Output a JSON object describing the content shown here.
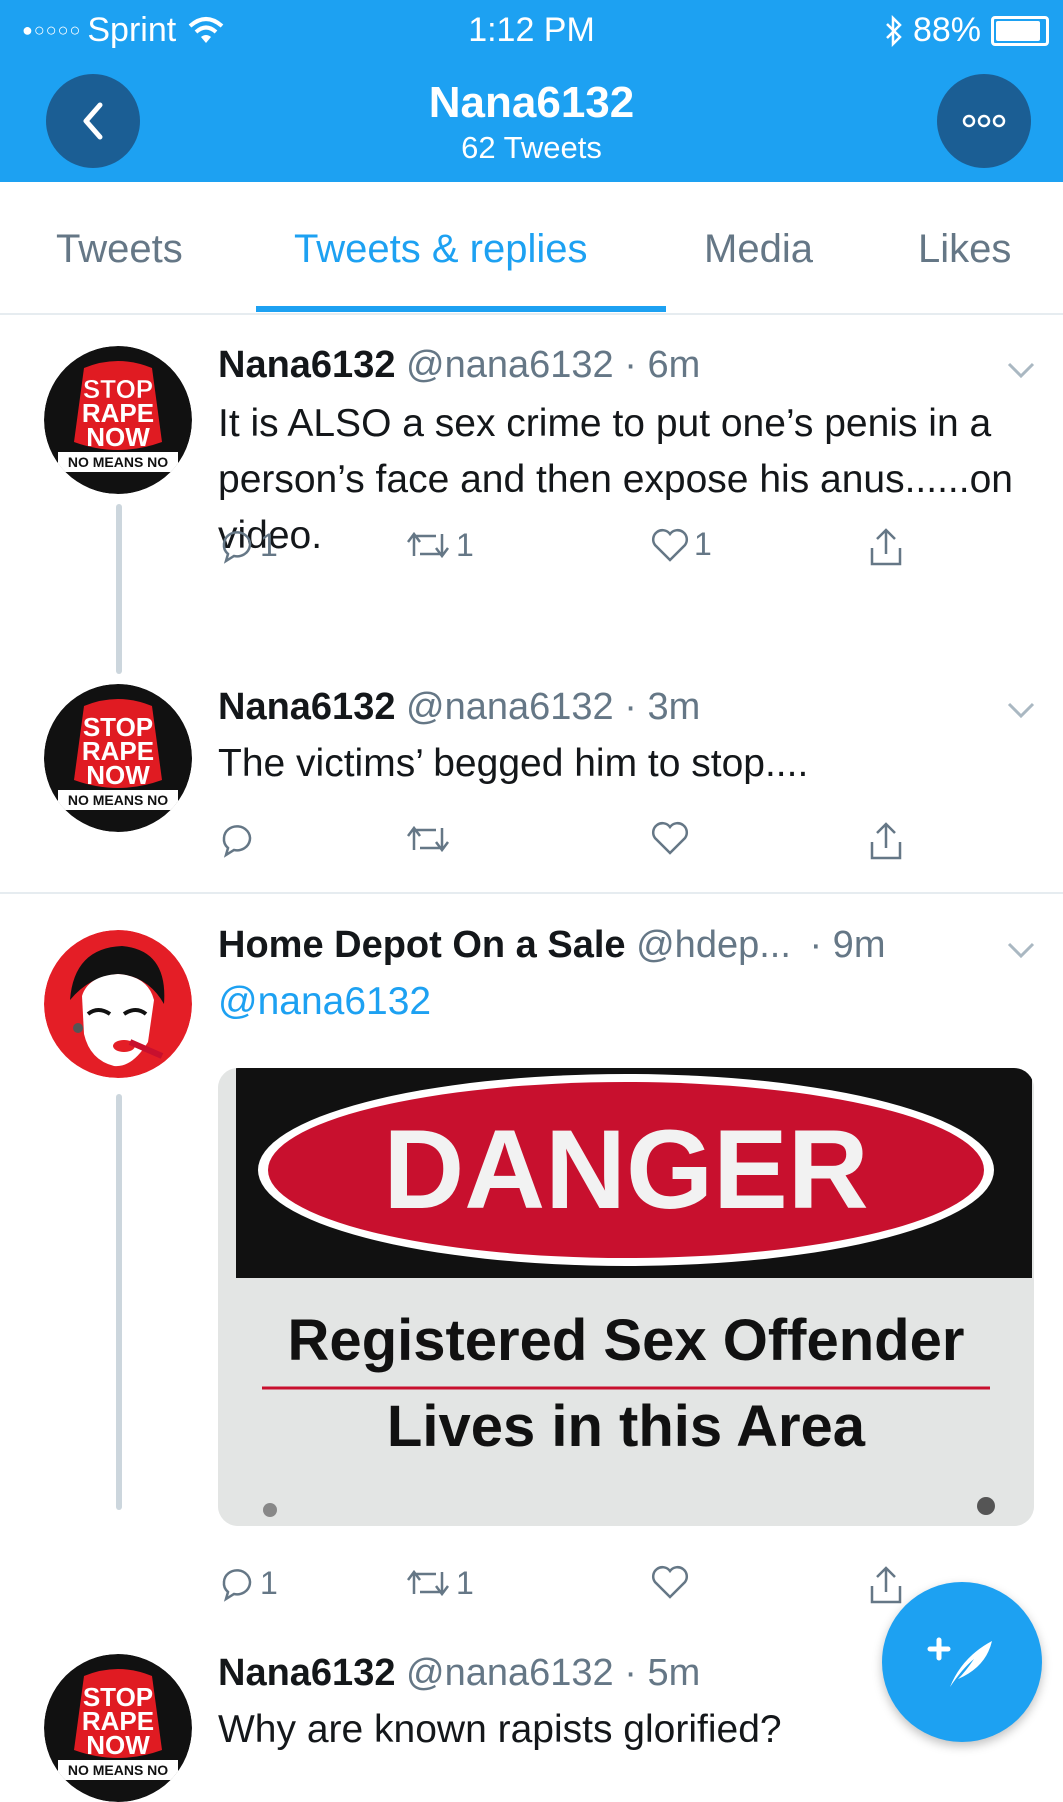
{
  "status_bar": {
    "carrier": "Sprint",
    "signal_dots": "●○○○○",
    "time": "1:12 PM",
    "battery": "88%"
  },
  "header": {
    "title": "Nana6132",
    "subtitle": "62 Tweets",
    "more_label": "ooo"
  },
  "tabs": [
    {
      "label": "Tweets",
      "active": false
    },
    {
      "label": "Tweets & replies",
      "active": true
    },
    {
      "label": "Media",
      "active": false
    },
    {
      "label": "Likes",
      "active": false
    }
  ],
  "tweets": [
    {
      "name": "Nana6132",
      "handle": "@nana6132",
      "time": "· 6m",
      "text": "It is ALSO a sex crime to put one’s penis in a person’s face and then expose his anus......on video.",
      "replies": "1",
      "retweets": "1",
      "likes": "1",
      "avatar": "stop-rape-now-logo"
    },
    {
      "name": "Nana6132",
      "handle": "@nana6132",
      "time": "· 3m",
      "text": "The victims’ begged him to stop....",
      "replies": "",
      "retweets": "",
      "likes": "",
      "avatar": "stop-rape-now-logo"
    },
    {
      "name": "Home Depot On a Sale",
      "handle": "@hdep...",
      "time": "· 9m",
      "mention": "@nana6132",
      "replies": "1",
      "retweets": "1",
      "likes": "",
      "avatar": "pop-art-woman-avatar",
      "image": {
        "headline": "DANGER",
        "line1": "Registered Sex Offender",
        "line2": "Lives in this Area"
      }
    },
    {
      "name": "Nana6132",
      "handle": "@nana6132",
      "time": "· 5m",
      "text": "Why are known rapists glorified?",
      "avatar": "stop-rape-now-logo"
    }
  ],
  "logo_text": {
    "stop": "STOP",
    "rape": "RAPE",
    "now": "NOW",
    "tag": "NO MEANS NO"
  },
  "colors": {
    "brand": "#1da1f2",
    "header_button": "#1b5e94",
    "muted": "#657786",
    "danger_red": "#c8102e"
  },
  "icons": {
    "back": "chevron-left-icon",
    "more": "more-dots-icon",
    "reply": "reply-icon",
    "retweet": "retweet-icon",
    "like": "heart-icon",
    "share": "share-icon",
    "compose": "compose-tweet-icon"
  }
}
